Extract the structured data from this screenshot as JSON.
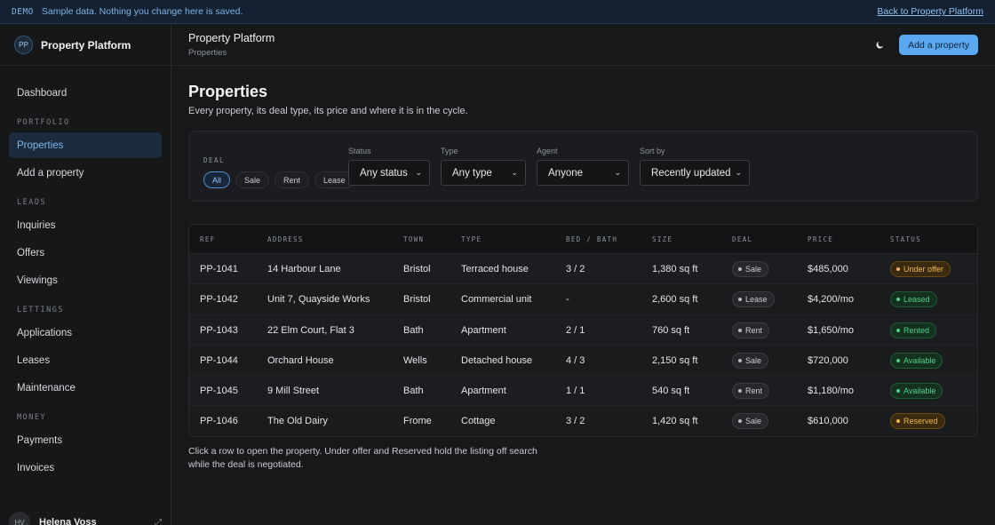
{
  "demo": {
    "tag": "DEMO",
    "message": "Sample data. Nothing you change here is saved.",
    "back_link": "Back to Property Platform"
  },
  "sidebar": {
    "brand_initials": "PP",
    "brand_name": "Property Platform",
    "dashboard": "Dashboard",
    "sections": {
      "portfolio": "PORTFOLIO",
      "leads": "LEADS",
      "lettings": "LETTINGS",
      "money": "MONEY"
    },
    "items": {
      "properties": "Properties",
      "add_property": "Add a property",
      "inquiries": "Inquiries",
      "offers": "Offers",
      "viewings": "Viewings",
      "applications": "Applications",
      "leases": "Leases",
      "maintenance": "Maintenance",
      "payments": "Payments",
      "invoices": "Invoices"
    },
    "active_item": "properties",
    "user": {
      "initials": "HV",
      "name": "Helena Voss"
    }
  },
  "header": {
    "title": "Property Platform",
    "breadcrumb": "Properties",
    "theme_icon": "moon-icon",
    "add_button": "Add a property"
  },
  "page": {
    "title": "Properties",
    "subtitle": "Every property, its deal type, its price and where it is in the cycle."
  },
  "filters": {
    "deal_label": "DEAL",
    "deal_options": [
      "All",
      "Sale",
      "Rent",
      "Lease"
    ],
    "deal_selected": "All",
    "status": {
      "label": "Status",
      "value": "Any status"
    },
    "type": {
      "label": "Type",
      "value": "Any type"
    },
    "agent": {
      "label": "Agent",
      "value": "Anyone"
    },
    "sort": {
      "label": "Sort by",
      "value": "Recently updated"
    }
  },
  "table": {
    "columns": [
      "REF",
      "ADDRESS",
      "TOWN",
      "TYPE",
      "BED / BATH",
      "SIZE",
      "DEAL",
      "PRICE",
      "STATUS"
    ],
    "rows": [
      {
        "ref": "PP-1041",
        "address": "14 Harbour Lane",
        "town": "Bristol",
        "type": "Terraced house",
        "bedbath": "3 / 2",
        "size": "1,380 sq ft",
        "deal": "Sale",
        "price": "$485,000",
        "status": "Under offer",
        "status_kind": "amber"
      },
      {
        "ref": "PP-1042",
        "address": "Unit 7, Quayside Works",
        "town": "Bristol",
        "type": "Commercial unit",
        "bedbath": "-",
        "size": "2,600 sq ft",
        "deal": "Lease",
        "price": "$4,200/mo",
        "status": "Leased",
        "status_kind": "green"
      },
      {
        "ref": "PP-1043",
        "address": "22 Elm Court, Flat 3",
        "town": "Bath",
        "type": "Apartment",
        "bedbath": "2 / 1",
        "size": "760 sq ft",
        "deal": "Rent",
        "price": "$1,650/mo",
        "status": "Rented",
        "status_kind": "green"
      },
      {
        "ref": "PP-1044",
        "address": "Orchard House",
        "town": "Wells",
        "type": "Detached house",
        "bedbath": "4 / 3",
        "size": "2,150 sq ft",
        "deal": "Sale",
        "price": "$720,000",
        "status": "Available",
        "status_kind": "green"
      },
      {
        "ref": "PP-1045",
        "address": "9 Mill Street",
        "town": "Bath",
        "type": "Apartment",
        "bedbath": "1 / 1",
        "size": "540 sq ft",
        "deal": "Rent",
        "price": "$1,180/mo",
        "status": "Available",
        "status_kind": "green"
      },
      {
        "ref": "PP-1046",
        "address": "The Old Dairy",
        "town": "Frome",
        "type": "Cottage",
        "bedbath": "3 / 2",
        "size": "1,420 sq ft",
        "deal": "Sale",
        "price": "$610,000",
        "status": "Reserved",
        "status_kind": "amber"
      }
    ]
  },
  "footnote": "Click a row to open the property. Under offer and Reserved hold the listing off search while the deal is negotiated.",
  "colors": {
    "accent": "#5aa9f0",
    "status_green_bg": "#14301f",
    "status_green_fg": "#4fd08a",
    "status_amber_bg": "#3a2a0f",
    "status_amber_fg": "#f0b64a"
  }
}
